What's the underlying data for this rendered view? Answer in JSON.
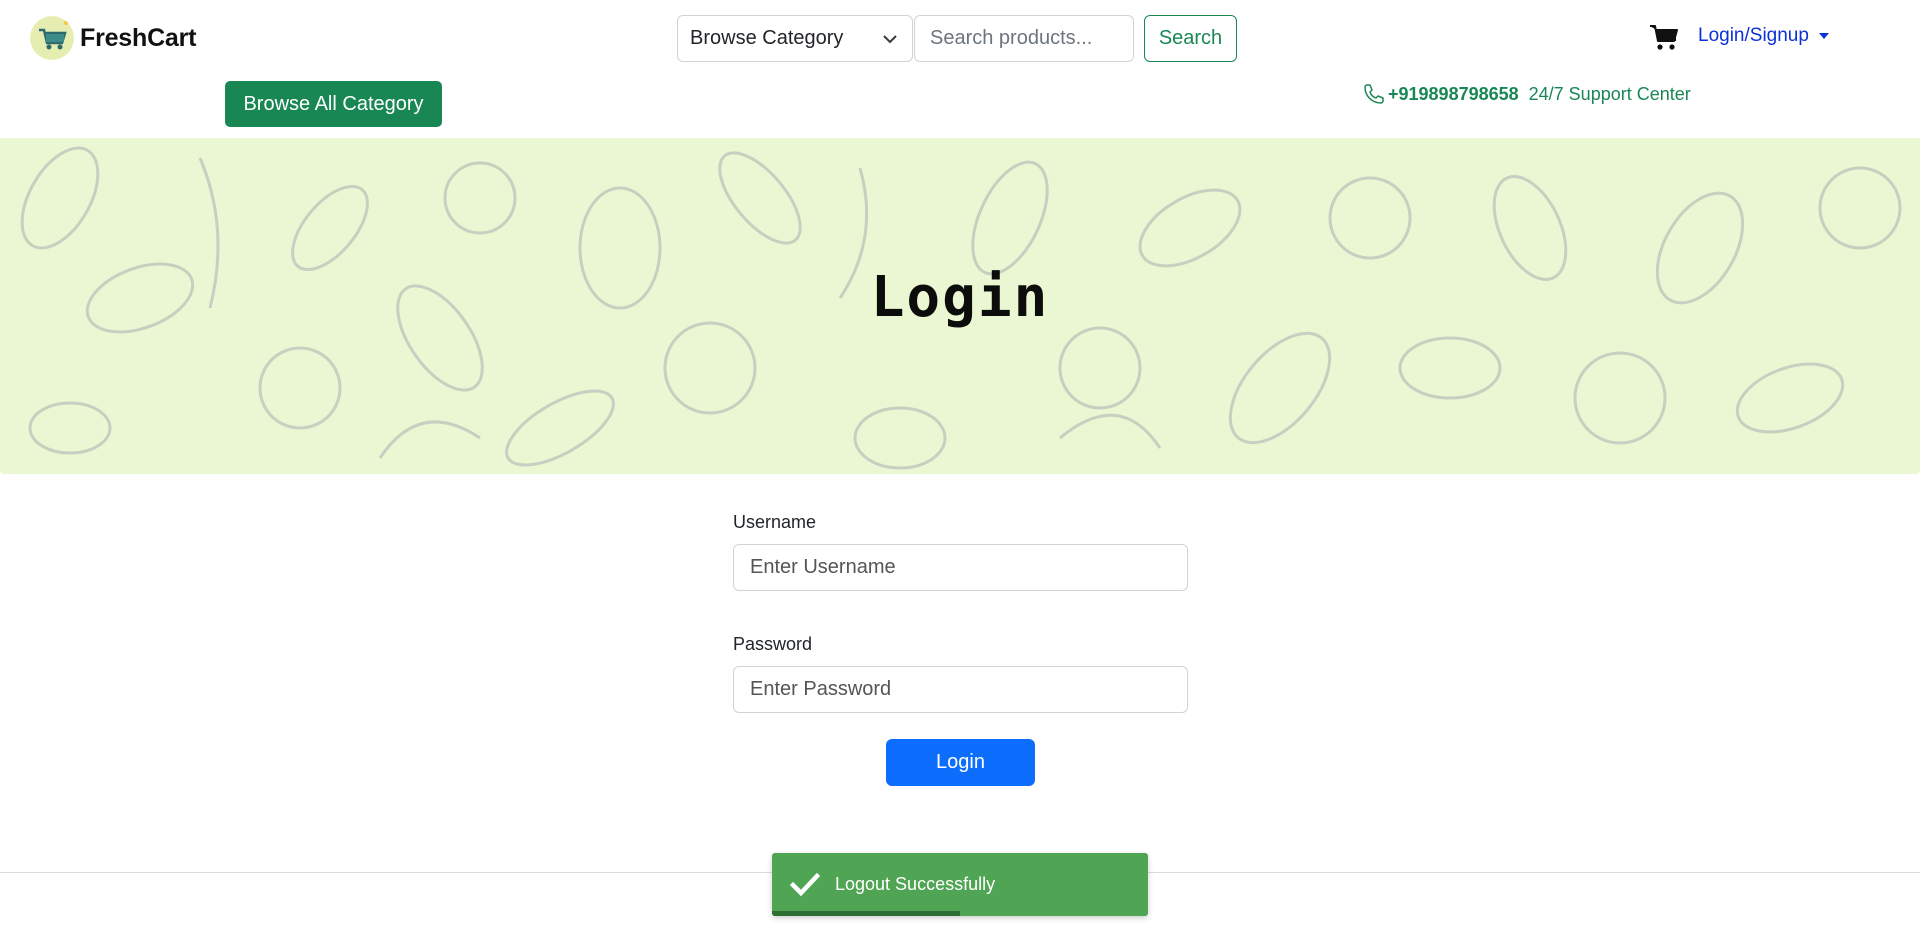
{
  "brand": {
    "name": "FreshCart",
    "logo_icon": "cart-logo-icon"
  },
  "header": {
    "category_select": {
      "selected": "Browse Category"
    },
    "search": {
      "placeholder": "Search products...",
      "button_label": "Search"
    },
    "cart_icon": "shopping-cart-icon",
    "account_menu_label": "Login/Signup"
  },
  "subheader": {
    "browse_all_label": "Browse All Category",
    "support": {
      "phone": "+919898798658",
      "text": "24/7 Support Center"
    }
  },
  "hero": {
    "title": "Login"
  },
  "form": {
    "username": {
      "label": "Username",
      "placeholder": "Enter Username",
      "value": ""
    },
    "password": {
      "label": "Password",
      "placeholder": "Enter Password",
      "value": ""
    },
    "submit_label": "Login"
  },
  "toast": {
    "message": "Logout Successfully",
    "progress": 0.5
  },
  "colors": {
    "brand_green": "#198754",
    "primary_blue": "#0d6efd",
    "link_blue": "#0d31d8",
    "hero_bg": "#eaf7d2",
    "toast_bg": "#4fa553"
  }
}
